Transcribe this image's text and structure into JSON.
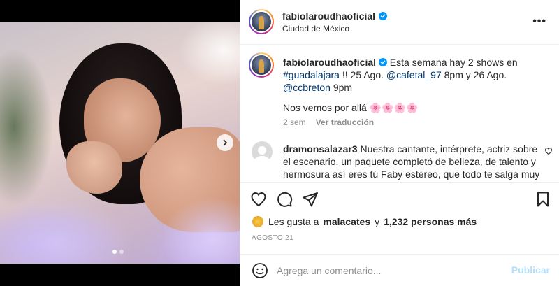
{
  "post": {
    "username": "fabiolaroudhaoficial",
    "location": "Ciudad de México",
    "verified": true,
    "carousel": {
      "current": 1,
      "total": 2
    }
  },
  "caption": {
    "username": "fabiolaroudhaoficial",
    "text_1": "Esta semana hay 2 shows en",
    "hashtag": "#guadalajara",
    "text_2": "!! 25 Ago.",
    "mention_1": "@cafetal_97",
    "text_3": "8pm y 26 Ago.",
    "mention_2": "@ccbreton",
    "text_4": "9pm",
    "line_2": "Nos vemos por allá 🌸🌸🌸🌸",
    "time": "2 sem",
    "translate_label": "Ver traducción"
  },
  "comment": {
    "username": "dramonsalazar3",
    "text": "Nuestra cantante, intérprete, actriz sobre el escenario, un paquete completó de belleza, de talento y hermosura así eres tú Faby estéreo, que todo te salga muy"
  },
  "likes": {
    "prefix": "Les gusta a",
    "liker": "malacates",
    "connector": "y",
    "others": "1,232 personas más"
  },
  "date": "AGOSTO 21",
  "add_comment": {
    "placeholder": "Agrega un comentario...",
    "publish_label": "Publicar"
  },
  "icons": {
    "more": "more-icon",
    "verified": "verified-badge-icon",
    "next": "chevron-right-icon",
    "like": "heart-icon",
    "comment": "comment-icon",
    "share": "paper-plane-icon",
    "save": "bookmark-icon",
    "emoji": "emoji-icon"
  },
  "colors": {
    "link": "#00376b",
    "verified": "#0095f6",
    "muted": "#8e8e8e",
    "publish_disabled": "#b2dffc"
  }
}
